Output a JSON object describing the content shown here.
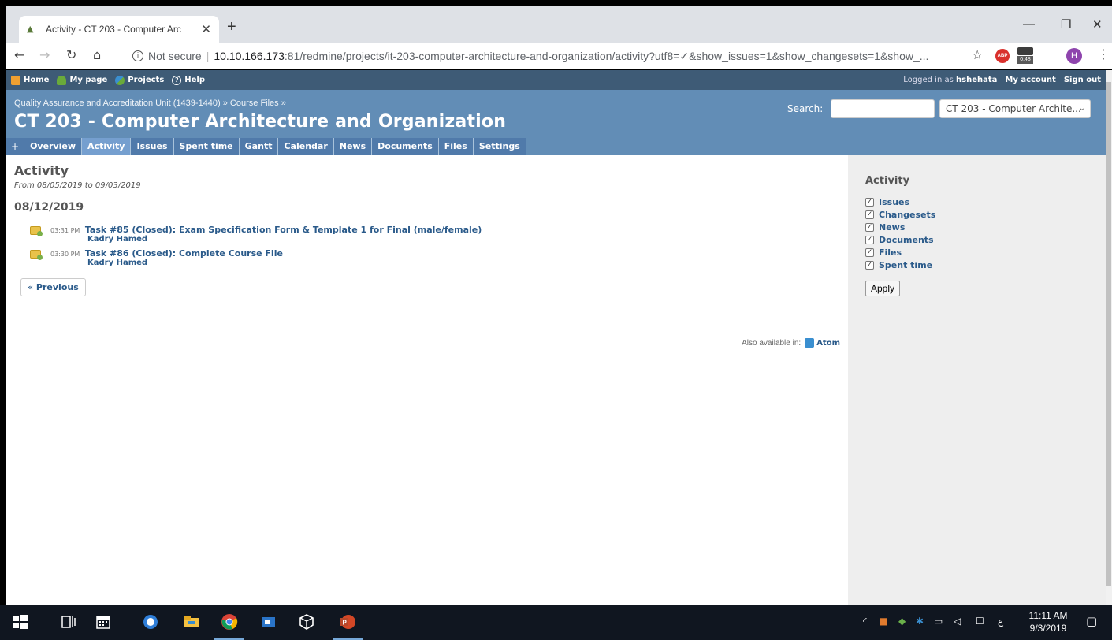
{
  "browser": {
    "tab_title": "Activity - CT 203 - Computer Arc",
    "tab_close": "✕",
    "new_tab": "+",
    "security_label": "Not secure",
    "url_host": "10.10.166.173",
    "url_rest": ":81/redmine/projects/it-203-computer-architecture-and-organization/activity?utf8=✓&show_issues=1&show_changesets=1&show_...",
    "abp_label": "ABP",
    "ext_badge": "0:48",
    "profile_initial": "H",
    "icons": [
      "back-arrow-icon",
      "forward-arrow-icon",
      "reload-icon",
      "home-icon",
      "info-icon",
      "star-icon",
      "menu-kebab-icon"
    ]
  },
  "top_menu": {
    "home": "Home",
    "my_page": "My page",
    "projects": "Projects",
    "help": "Help",
    "logged_in_prefix": "Logged in as",
    "username": "hshehata",
    "my_account": "My account",
    "sign_out": "Sign out"
  },
  "header": {
    "breadcrumb": "Quality Assurance and Accreditation Unit (1439-1440) » Course Files »",
    "title": "CT 203 - Computer Architecture and Organization",
    "search_label": "Search:",
    "search_value": "",
    "jump_select": "CT 203 - Computer Archite..."
  },
  "main_menu": {
    "plus": "+",
    "tabs": [
      "Overview",
      "Activity",
      "Issues",
      "Spent time",
      "Gantt",
      "Calendar",
      "News",
      "Documents",
      "Files",
      "Settings"
    ],
    "selected": "Activity"
  },
  "content": {
    "heading": "Activity",
    "date_range": "From 08/05/2019 to 09/03/2019",
    "day_heading": "08/12/2019",
    "events": [
      {
        "time": "03:31 PM",
        "title": "Task #85 (Closed): Exam Specification Form & Template 1 for Final (male/female)",
        "author": "Kadry Hamed"
      },
      {
        "time": "03:30 PM",
        "title": "Task #86 (Closed): Complete Course File",
        "author": "Kadry Hamed"
      }
    ],
    "previous": "« Previous",
    "also_available": "Also available in:",
    "atom": "Atom"
  },
  "sidebar": {
    "title": "Activity",
    "options": [
      "Issues",
      "Changesets",
      "News",
      "Documents",
      "Files",
      "Spent time"
    ],
    "checkmark": "✓",
    "apply": "Apply"
  },
  "taskbar": {
    "time": "11:11 AM",
    "date": "9/3/2019",
    "lang": "ع"
  }
}
